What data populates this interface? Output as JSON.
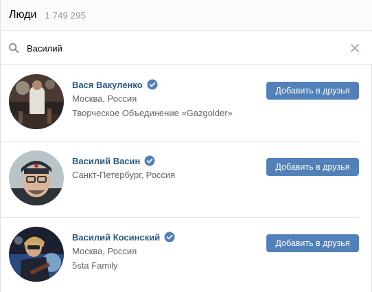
{
  "header": {
    "title": "Люди",
    "count": "1 749 295"
  },
  "search": {
    "value": "Василий",
    "placeholder": ""
  },
  "people": [
    {
      "name": "Вася Вакуленко",
      "verified": true,
      "city": "Москва, Россия",
      "extra": "Творческое Объединение «Gazgolder»",
      "button_label": "Добавить в друзья"
    },
    {
      "name": "Василий Васин",
      "verified": true,
      "city": "Санкт-Петербург, Россия",
      "extra": "",
      "button_label": "Добавить в друзья"
    },
    {
      "name": "Василий Косинский",
      "verified": true,
      "city": "Москва, Россия",
      "extra": "5sta Family",
      "button_label": "Добавить в друзья"
    }
  ],
  "colors": {
    "link": "#2a5885",
    "button": "#5181b8",
    "verified": "#5181b8",
    "muted": "#939699"
  }
}
